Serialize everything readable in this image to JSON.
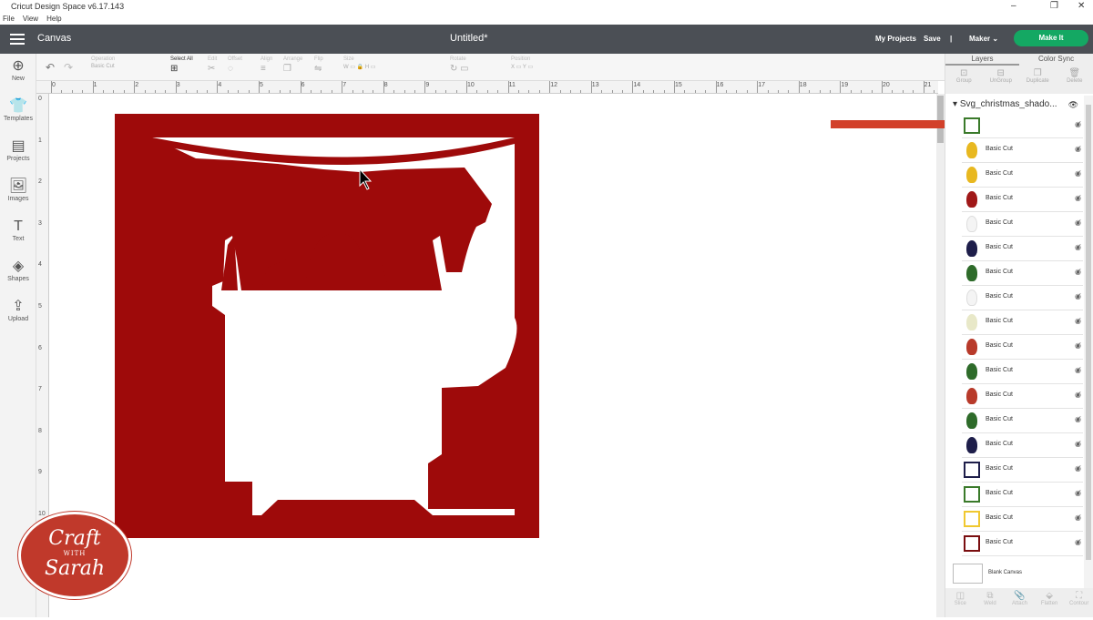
{
  "window": {
    "title": "Cricut Design Space  v6.17.143",
    "menu": [
      "File",
      "View",
      "Help"
    ]
  },
  "header": {
    "section": "Canvas",
    "document": "Untitled*",
    "my_projects": "My Projects",
    "save": "Save",
    "separator": "|",
    "machine": "Maker",
    "make_it": "Make It"
  },
  "leftbar": [
    {
      "label": "New",
      "icon": "⊕"
    },
    {
      "label": "Templates",
      "icon": "👕"
    },
    {
      "label": "Projects",
      "icon": "▤"
    },
    {
      "label": "Images",
      "icon": "🖼"
    },
    {
      "label": "Text",
      "icon": "T"
    },
    {
      "label": "Shapes",
      "icon": "◈"
    },
    {
      "label": "Upload",
      "icon": "⇪"
    }
  ],
  "toolbar": {
    "operation": "Operation",
    "operation_value": "Basic Cut",
    "select_all": "Select All",
    "edit": "Edit",
    "offset": "Offset",
    "align": "Align",
    "arrange": "Arrange",
    "flip": "Flip",
    "size": "Size",
    "w": "W",
    "h": "H",
    "rotate": "Rotate",
    "position": "Position",
    "x": "X",
    "y": "Y"
  },
  "ruler_top": [
    "0",
    "1",
    "2",
    "3",
    "4",
    "5",
    "6",
    "7",
    "8",
    "9",
    "10",
    "11",
    "12",
    "13",
    "14",
    "15",
    "16",
    "17",
    "18",
    "19",
    "20",
    "21"
  ],
  "ruler_left": [
    "0",
    "1",
    "2",
    "3",
    "4",
    "5",
    "6",
    "7",
    "8",
    "9",
    "10",
    "11"
  ],
  "panel": {
    "tabs": [
      "Layers",
      "Color Sync"
    ],
    "tools": [
      "Group",
      "UnGroup",
      "Duplicate",
      "Delete"
    ],
    "group_name": "Svg_christmas_shado...",
    "layers": [
      {
        "label": "",
        "color": "#3a7a2a"
      },
      {
        "label": "Basic Cut",
        "color": "#e8b820"
      },
      {
        "label": "Basic Cut",
        "color": "#e8b820"
      },
      {
        "label": "Basic Cut",
        "color": "#a01818"
      },
      {
        "label": "Basic Cut",
        "color": "#f4f4f4"
      },
      {
        "label": "Basic Cut",
        "color": "#1e1e4a"
      },
      {
        "label": "Basic Cut",
        "color": "#2e6b2a"
      },
      {
        "label": "Basic Cut",
        "color": "#f4f4f4"
      },
      {
        "label": "Basic Cut",
        "color": "#e8e8c8"
      },
      {
        "label": "Basic Cut",
        "color": "#b83a2a"
      },
      {
        "label": "Basic Cut",
        "color": "#2e6b2a"
      },
      {
        "label": "Basic Cut",
        "color": "#b83a2a"
      },
      {
        "label": "Basic Cut",
        "color": "#2e6b2a"
      },
      {
        "label": "Basic Cut",
        "color": "#1e1e4a"
      },
      {
        "label": "Basic Cut",
        "color": "#1e1e4a"
      },
      {
        "label": "Basic Cut",
        "color": "#3a7a2a"
      },
      {
        "label": "Basic Cut",
        "color": "#f0c830"
      },
      {
        "label": "Basic Cut",
        "color": "#7a0e10"
      }
    ],
    "blank_canvas": "Blank Canvas",
    "bottom_tools": [
      "Slice",
      "Weld",
      "Attach",
      "Flatten",
      "Contour"
    ]
  },
  "logo": {
    "line1": "Craft",
    "with": "WITH",
    "line2": "Sarah"
  },
  "colors": {
    "header": "#4b4f55",
    "make_it": "#14a863",
    "art": "#9e0a0a",
    "arrow": "#d2402a"
  }
}
